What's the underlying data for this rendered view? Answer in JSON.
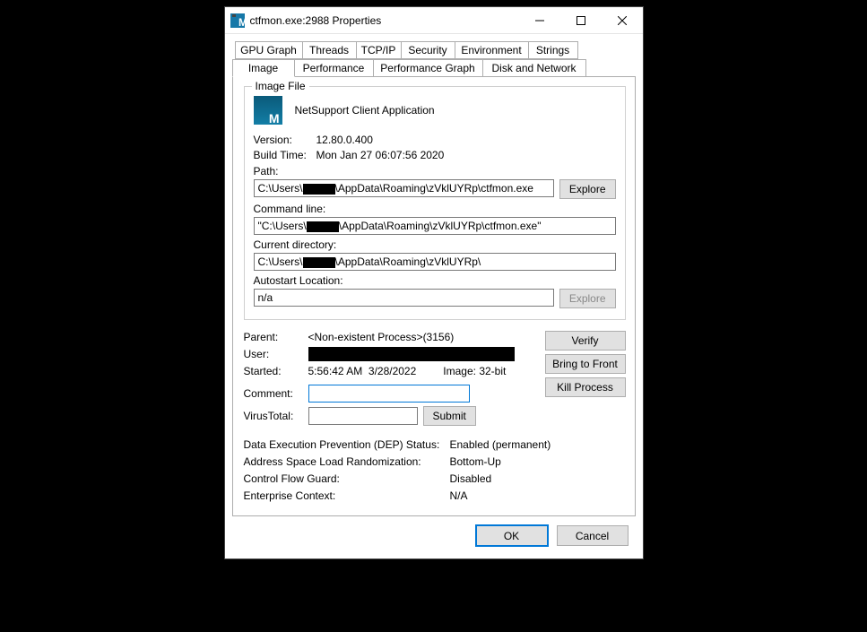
{
  "window": {
    "title": "ctfmon.exe:2988 Properties"
  },
  "tabsRow1": {
    "t0": "GPU Graph",
    "t1": "Threads",
    "t2": "TCP/IP",
    "t3": "Security",
    "t4": "Environment",
    "t5": "Strings"
  },
  "tabsRow2": {
    "t0": "Image",
    "t1": "Performance",
    "t2": "Performance Graph",
    "t3": "Disk and Network"
  },
  "imageFile": {
    "groupTitle": "Image File",
    "appDescription": "NetSupport Client Application",
    "versionLabel": "Version:",
    "versionValue": "12.80.0.400",
    "buildTimeLabel": "Build Time:",
    "buildTimeValue": "Mon Jan 27 06:07:56 2020",
    "pathLabel": "Path:",
    "pathPrefix": "C:\\Users\\",
    "pathSuffix": "\\AppData\\Roaming\\zVklUYRp\\ctfmon.exe",
    "exploreBtn": "Explore",
    "cmdLabel": "Command line:",
    "cmdPrefix": "\"C:\\Users\\",
    "cmdSuffix": "\\AppData\\Roaming\\zVklUYRp\\ctfmon.exe\"",
    "curDirLabel": "Current directory:",
    "curDirPrefix": "C:\\Users\\",
    "curDirSuffix": "\\AppData\\Roaming\\zVklUYRp\\",
    "autostartLabel": "Autostart Location:",
    "autostartValue": "n/a"
  },
  "info": {
    "parentLabel": "Parent:",
    "parentValue": "<Non-existent Process>(3156)",
    "userLabel": "User:",
    "startedLabel": "Started:",
    "startedTime": "5:56:42 AM",
    "startedDate": "3/28/2022",
    "imageBitsLabel": "Image:",
    "imageBitsValue": "32-bit",
    "commentLabel": "Comment:",
    "virusTotalLabel": "VirusTotal:",
    "submitBtn": "Submit",
    "verifyBtn": "Verify",
    "bringFrontBtn": "Bring to Front",
    "killBtn": "Kill Process"
  },
  "status": {
    "depLabel": "Data Execution Prevention (DEP) Status:",
    "depVal": "Enabled (permanent)",
    "aslrLabel": "Address Space Load Randomization:",
    "aslrVal": "Bottom-Up",
    "cfgLabel": "Control Flow Guard:",
    "cfgVal": "Disabled",
    "entLabel": "Enterprise Context:",
    "entVal": "N/A"
  },
  "dialog": {
    "ok": "OK",
    "cancel": "Cancel"
  }
}
